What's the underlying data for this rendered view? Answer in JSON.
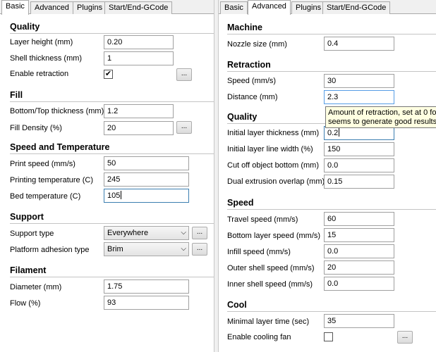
{
  "left": {
    "tabs": [
      "Basic",
      "Advanced",
      "Plugins",
      "Start/End-GCode"
    ],
    "active_tab": "Basic",
    "quality": {
      "title": "Quality",
      "layer_height_label": "Layer height (mm)",
      "layer_height": "0.20",
      "shell_thickness_label": "Shell thickness (mm)",
      "shell_thickness": "1",
      "enable_retraction_label": "Enable retraction",
      "enable_retraction_check": "✔",
      "more_label": "..."
    },
    "fill": {
      "title": "Fill",
      "bottom_top_label": "Bottom/Top thickness (mm)",
      "bottom_top": "1.2",
      "density_label": "Fill Density (%)",
      "density": "20",
      "more_label": "..."
    },
    "speed_temp": {
      "title": "Speed and Temperature",
      "print_speed_label": "Print speed (mm/s)",
      "print_speed": "50",
      "printing_temp_label": "Printing temperature (C)",
      "printing_temp": "245",
      "bed_temp_label": "Bed temperature (C)",
      "bed_temp": "105"
    },
    "support": {
      "title": "Support",
      "support_type_label": "Support type",
      "support_type": "Everywhere",
      "adhesion_label": "Platform adhesion type",
      "adhesion": "Brim",
      "more_label": "..."
    },
    "filament": {
      "title": "Filament",
      "diameter_label": "Diameter (mm)",
      "diameter": "1.75",
      "flow_label": "Flow (%)",
      "flow": "93"
    }
  },
  "right": {
    "tabs": [
      "Basic",
      "Advanced",
      "Plugins",
      "Start/End-GCode"
    ],
    "active_tab": "Advanced",
    "machine": {
      "title": "Machine",
      "nozzle_label": "Nozzle size (mm)",
      "nozzle": "0.4"
    },
    "retraction": {
      "title": "Retraction",
      "speed_label": "Speed (mm/s)",
      "speed": "30",
      "distance_label": "Distance (mm)",
      "distance": "2.3"
    },
    "quality": {
      "title": "Quality",
      "initial_layer_label": "Initial layer thickness (mm)",
      "initial_layer": "0.2",
      "initial_width_label": "Initial layer line width (%)",
      "initial_width": "150",
      "cutoff_label": "Cut off object bottom (mm)",
      "cutoff": "0.0",
      "dual_overlap_label": "Dual extrusion overlap (mm)",
      "dual_overlap": "0.15"
    },
    "speed": {
      "title": "Speed",
      "travel_label": "Travel speed (mm/s)",
      "travel": "60",
      "bottom_label": "Bottom layer speed (mm/s)",
      "bottom": "15",
      "infill_label": "Infill speed (mm/s)",
      "infill": "0.0",
      "outer_label": "Outer shell speed (mm/s)",
      "outer": "20",
      "inner_label": "Inner shell speed (mm/s)",
      "inner": "0.0"
    },
    "cool": {
      "title": "Cool",
      "min_layer_label": "Minimal layer time (sec)",
      "min_layer": "35",
      "fan_label": "Enable cooling fan",
      "more_label": "..."
    },
    "tooltip": {
      "line1": "Amount of retraction, set at 0 fo",
      "line2": "seems to generate good results."
    }
  },
  "icons": {
    "checkmark": "checkmark-icon",
    "dropdown": "chevron-down-icon",
    "caret": "text-caret"
  }
}
